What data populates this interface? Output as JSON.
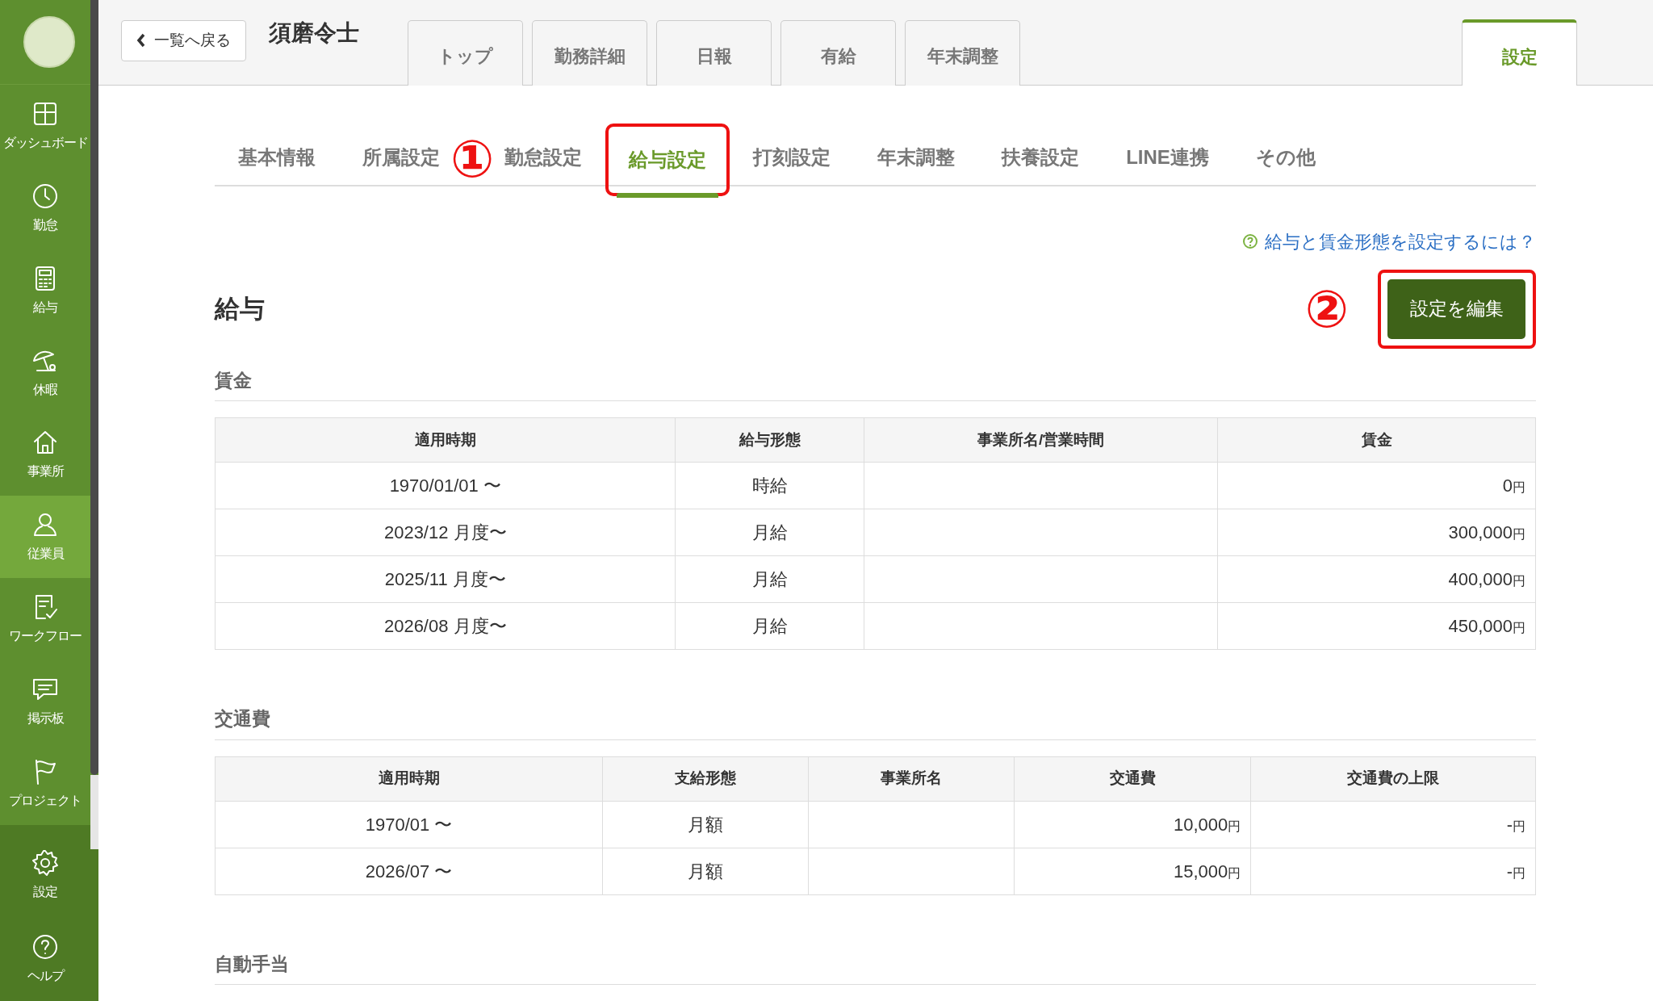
{
  "sidebar": {
    "items": [
      {
        "label": "ダッシュボード",
        "selected": false
      },
      {
        "label": "勤怠",
        "selected": false
      },
      {
        "label": "給与",
        "selected": false
      },
      {
        "label": "休暇",
        "selected": false
      },
      {
        "label": "事業所",
        "selected": false
      },
      {
        "label": "従業員",
        "selected": true
      },
      {
        "label": "ワークフロー",
        "selected": false
      },
      {
        "label": "掲示板",
        "selected": false
      },
      {
        "label": "プロジェクト",
        "selected": false
      }
    ],
    "bottom_items": [
      {
        "label": "設定"
      },
      {
        "label": "ヘルプ"
      }
    ]
  },
  "header": {
    "back_button": "一覧へ戻る",
    "employee_name": "須磨令士",
    "tabs": [
      {
        "label": "トップ",
        "selected": false
      },
      {
        "label": "勤務詳細",
        "selected": false
      },
      {
        "label": "日報",
        "selected": false
      },
      {
        "label": "有給",
        "selected": false
      },
      {
        "label": "年末調整",
        "selected": false
      }
    ],
    "settings_tab": {
      "label": "設定",
      "selected": true
    }
  },
  "sub_tabs": [
    {
      "label": "基本情報",
      "selected": false,
      "highlighted": false
    },
    {
      "label": "所属設定",
      "selected": false,
      "highlighted": false
    },
    {
      "label": "勤怠設定",
      "selected": false,
      "highlighted": false
    },
    {
      "label": "給与設定",
      "selected": true,
      "highlighted": true
    },
    {
      "label": "打刻設定",
      "selected": false,
      "highlighted": false
    },
    {
      "label": "年末調整",
      "selected": false,
      "highlighted": false
    },
    {
      "label": "扶養設定",
      "selected": false,
      "highlighted": false
    },
    {
      "label": "LINE連携",
      "selected": false,
      "highlighted": false
    },
    {
      "label": "その他",
      "selected": false,
      "highlighted": false
    }
  ],
  "annotations": [
    {
      "label": "①"
    },
    {
      "label": "②"
    }
  ],
  "help_link": "給与と賃金形態を設定するには？",
  "section_title": "給与",
  "edit_button": {
    "label": "設定を編集",
    "highlighted": true
  },
  "wage": {
    "title": "賃金",
    "columns": [
      "適用時期",
      "給与形態",
      "事業所名/営業時間",
      "賃金"
    ],
    "rows": [
      {
        "period": "1970/01/01 〜",
        "type": "時給",
        "office": "",
        "amount": "0",
        "unit": "円"
      },
      {
        "period": "2023/12 月度〜",
        "type": "月給",
        "office": "",
        "amount": "300,000",
        "unit": "円"
      },
      {
        "period": "2025/11 月度〜",
        "type": "月給",
        "office": "",
        "amount": "400,000",
        "unit": "円"
      },
      {
        "period": "2026/08 月度〜",
        "type": "月給",
        "office": "",
        "amount": "450,000",
        "unit": "円"
      }
    ]
  },
  "commute": {
    "title": "交通費",
    "columns": [
      "適用時期",
      "支給形態",
      "事業所名",
      "交通費",
      "交通費の上限"
    ],
    "rows": [
      {
        "period": "1970/01 〜",
        "type": "月額",
        "office": "",
        "amount": "10,000",
        "unit": "円",
        "limit": "-",
        "limit_unit": "円"
      },
      {
        "period": "2026/07 〜",
        "type": "月額",
        "office": "",
        "amount": "15,000",
        "unit": "円",
        "limit": "-",
        "limit_unit": "円"
      }
    ]
  },
  "allowance": {
    "title": "自動手当"
  }
}
